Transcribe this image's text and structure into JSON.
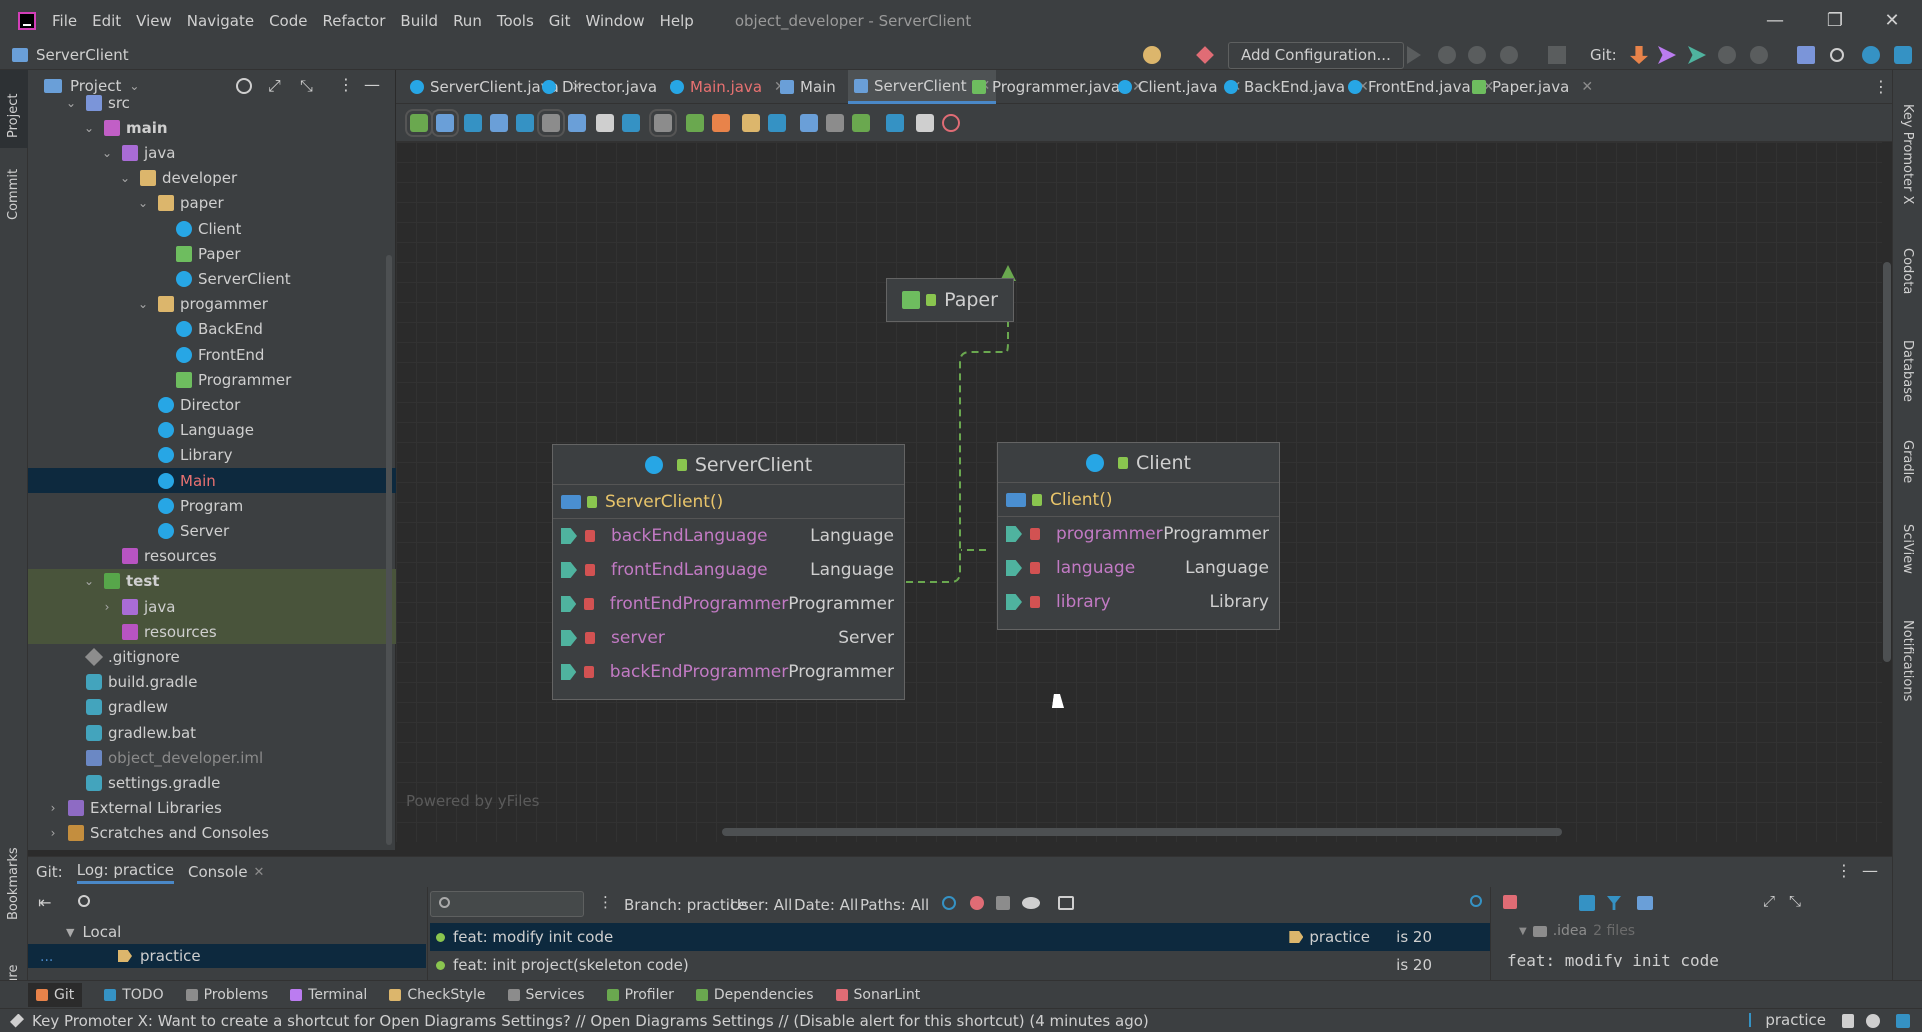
{
  "menu": {
    "items": [
      "File",
      "Edit",
      "View",
      "Navigate",
      "Code",
      "Refactor",
      "Build",
      "Run",
      "Tools",
      "Git",
      "Window",
      "Help"
    ],
    "window_title": "object_developer - ServerClient",
    "minimize": "—",
    "maximize": "❐",
    "close": "✕"
  },
  "navbar": {
    "breadcrumb": "ServerClient",
    "add_configuration": "Add Configuration...",
    "git_label": "Git:"
  },
  "stripes": {
    "left_top": [
      "Project",
      "Commit"
    ],
    "left_bottom": [
      "Bookmarks",
      "Structure"
    ],
    "right": [
      "Key Promoter X",
      "Codota",
      "Database",
      "Gradle",
      "SciView",
      "Notifications"
    ]
  },
  "project": {
    "title": "Project",
    "tree": [
      {
        "label": "src",
        "depth": 2,
        "arrow": "expanded",
        "icon": "folder-src"
      },
      {
        "label": "main",
        "depth": 3,
        "arrow": "expanded",
        "icon": "folder-main",
        "bold": true
      },
      {
        "label": "java",
        "depth": 4,
        "arrow": "expanded",
        "icon": "folder-java"
      },
      {
        "label": "developer",
        "depth": 5,
        "arrow": "expanded",
        "icon": "folder"
      },
      {
        "label": "paper",
        "depth": 6,
        "arrow": "expanded",
        "icon": "folder"
      },
      {
        "label": "Client",
        "depth": 7,
        "icon": "class"
      },
      {
        "label": "Paper",
        "depth": 7,
        "icon": "iface"
      },
      {
        "label": "ServerClient",
        "depth": 7,
        "icon": "class"
      },
      {
        "label": "progammer",
        "depth": 6,
        "arrow": "expanded",
        "icon": "folder"
      },
      {
        "label": "BackEnd",
        "depth": 7,
        "icon": "class"
      },
      {
        "label": "FrontEnd",
        "depth": 7,
        "icon": "class"
      },
      {
        "label": "Programmer",
        "depth": 7,
        "icon": "iface"
      },
      {
        "label": "Director",
        "depth": 6,
        "icon": "class"
      },
      {
        "label": "Language",
        "depth": 6,
        "icon": "class"
      },
      {
        "label": "Library",
        "depth": 6,
        "icon": "class"
      },
      {
        "label": "Main",
        "depth": 6,
        "icon": "class",
        "selected": true
      },
      {
        "label": "Program",
        "depth": 6,
        "icon": "class"
      },
      {
        "label": "Server",
        "depth": 6,
        "icon": "class"
      },
      {
        "label": "resources",
        "depth": 4,
        "icon": "folder-res"
      },
      {
        "label": "test",
        "depth": 3,
        "arrow": "expanded",
        "icon": "folder-test",
        "bold": true,
        "test": true
      },
      {
        "label": "java",
        "depth": 4,
        "arrow": "collapsed",
        "icon": "folder-java",
        "test": true
      },
      {
        "label": "resources",
        "depth": 4,
        "icon": "folder-res",
        "test": true
      },
      {
        "label": ".gitignore",
        "depth": 2,
        "icon": "git"
      },
      {
        "label": "build.gradle",
        "depth": 2,
        "icon": "gradle"
      },
      {
        "label": "gradlew",
        "depth": 2,
        "icon": "gradle"
      },
      {
        "label": "gradlew.bat",
        "depth": 2,
        "icon": "gradle"
      },
      {
        "label": "object_developer.iml",
        "depth": 2,
        "icon": "iml",
        "dim": true
      },
      {
        "label": "settings.gradle",
        "depth": 2,
        "icon": "gradle"
      },
      {
        "label": "External Libraries",
        "depth": 1,
        "arrow": "collapsed",
        "icon": "lib"
      },
      {
        "label": "Scratches and Consoles",
        "depth": 1,
        "arrow": "collapsed",
        "icon": "scratch"
      }
    ]
  },
  "tabs": [
    {
      "label": "ServerClient.java",
      "icon": "class"
    },
    {
      "label": "Director.java",
      "icon": "class"
    },
    {
      "label": "Main.java",
      "icon": "class",
      "red": true
    },
    {
      "label": "Main",
      "icon": "diag"
    },
    {
      "label": "ServerClient",
      "icon": "diag",
      "active": true
    },
    {
      "label": "Programmer.java",
      "icon": "ifc"
    },
    {
      "label": "Client.java",
      "icon": "class"
    },
    {
      "label": "BackEnd.java",
      "icon": "class"
    },
    {
      "label": "FrontEnd.java",
      "icon": "class"
    },
    {
      "label": "Paper.java",
      "icon": "ifc"
    }
  ],
  "diagram": {
    "paper": {
      "name": "Paper"
    },
    "server_client": {
      "name": "ServerClient",
      "constructor": "ServerClient()",
      "fields": [
        {
          "name": "backEndLanguage",
          "type": "Language"
        },
        {
          "name": "frontEndLanguage",
          "type": "Language"
        },
        {
          "name": "frontEndProgrammer",
          "type": "Programmer"
        },
        {
          "name": "server",
          "type": "Server"
        },
        {
          "name": "backEndProgrammer",
          "type": "Programmer"
        }
      ]
    },
    "client": {
      "name": "Client",
      "constructor": "Client()",
      "fields": [
        {
          "name": "programmer",
          "type": "Programmer"
        },
        {
          "name": "language",
          "type": "Language"
        },
        {
          "name": "library",
          "type": "Library"
        }
      ]
    },
    "powered_by": "Powered by yFiles"
  },
  "git_panel": {
    "label": "Git:",
    "tab_log": "Log: practice",
    "tab_console": "Console",
    "local_label": "Local",
    "branch": "practice",
    "filters": {
      "branch": "Branch: practice",
      "user": "User: All",
      "date": "Date: All",
      "paths": "Paths: All"
    },
    "commits": [
      {
        "message": "feat: modify init code",
        "tag": "practice",
        "author": "is 20"
      },
      {
        "message": "feat: init project(skeleton code)",
        "tag": "",
        "author": "is 20"
      }
    ],
    "details_folder": ".idea",
    "details_count": "2 files",
    "details_message": "feat: modify init code"
  },
  "tool_windows": [
    "Git",
    "TODO",
    "Problems",
    "Terminal",
    "CheckStyle",
    "Services",
    "Profiler",
    "Dependencies",
    "SonarLint"
  ],
  "status": {
    "message": "Key Promoter X: Want to create a shortcut for Open Diagrams Settings? // Open Diagrams Settings // (Disable alert for this shortcut) (4 minutes ago)",
    "branch": "practice"
  },
  "colors": {
    "accent": "#4a88c7",
    "field_name": "#c27ac4",
    "constructor": "#e8c46a",
    "selected_red": "#e87171",
    "realization_arrow": "#6aa84f"
  }
}
